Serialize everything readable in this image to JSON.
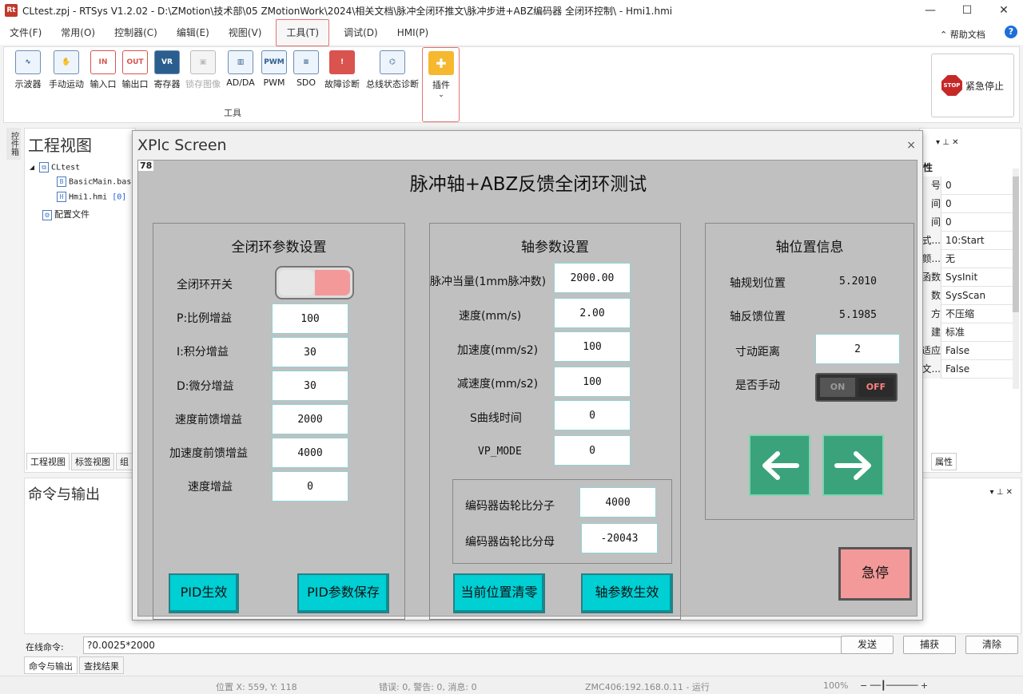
{
  "window": {
    "title": "CLtest.zpj - RTSys V1.2.02 - D:\\ZMotion\\技术部\\05 ZMotionWork\\2024\\相关文档\\脉冲全闭环推文\\脉冲步进+ABZ编码器  全闭环控制\\ - Hmi1.hmi",
    "app_icon": "Rt"
  },
  "menu": [
    "文件(F)",
    "常用(O)",
    "控制器(C)",
    "编辑(E)",
    "视图(V)",
    "工具(T)",
    "调试(D)",
    "HMI(P)"
  ],
  "menu_right": {
    "help": "帮助文档"
  },
  "ribbon": {
    "tools": [
      {
        "label": "示波器",
        "icon": "oscilloscope-icon",
        "glyph": "∿"
      },
      {
        "label": "手动运动",
        "icon": "hand-icon",
        "glyph": "✋"
      },
      {
        "label": "输入口",
        "icon": "input-icon",
        "glyph": "IN"
      },
      {
        "label": "输出口",
        "icon": "output-icon",
        "glyph": "OUT"
      },
      {
        "label": "寄存器",
        "icon": "register-icon",
        "glyph": "VR"
      },
      {
        "label": "锁存图像",
        "icon": "latch-image-icon",
        "glyph": "▣"
      },
      {
        "label": "AD/DA",
        "icon": "adda-icon",
        "glyph": "▥"
      },
      {
        "label": "PWM",
        "icon": "pwm-icon",
        "glyph": "PWM"
      },
      {
        "label": "SDO",
        "icon": "sdo-icon",
        "glyph": "≡"
      },
      {
        "label": "故障诊断",
        "icon": "fault-icon",
        "glyph": "!"
      },
      {
        "label": "总线状态诊断",
        "icon": "bus-icon",
        "glyph": "⌬"
      },
      {
        "label": "插件",
        "icon": "plugin-icon",
        "glyph": "✚"
      }
    ],
    "group_label": "工具",
    "estop": {
      "label": "紧急停止",
      "badge": "STOP"
    }
  },
  "side_tab": "控件箱",
  "project": {
    "header": "工程视图",
    "root": "CLtest",
    "file1": "BasicMain.bas",
    "file2": "Hmi1.hmi",
    "file2_tag": "[0]",
    "config": "配置文件",
    "tabs": [
      "工程视图",
      "标签视图",
      "组"
    ]
  },
  "props": {
    "head": "性",
    "rows": [
      {
        "k": "号",
        "v": "0"
      },
      {
        "k": "间",
        "v": "0"
      },
      {
        "k": "间",
        "v": "0"
      },
      {
        "k": "式...",
        "v": "10:Start"
      },
      {
        "k": "颜...",
        "v": "无"
      },
      {
        "k": "函数",
        "v": "SysInit"
      },
      {
        "k": "数",
        "v": "SysScan"
      },
      {
        "k": "方",
        "v": "不压缩"
      },
      {
        "k": "建",
        "v": "标准"
      },
      {
        "k": "适应",
        "v": "False"
      },
      {
        "k": "文...",
        "v": "False"
      }
    ],
    "tab": "属性"
  },
  "output": {
    "header": "命令与输出"
  },
  "command": {
    "label": "在线命令:",
    "value": "?0.0025*2000",
    "send": "发送",
    "capture": "捕获",
    "clear": "清除"
  },
  "out_tabs": [
    "命令与输出",
    "查找结果"
  ],
  "status": {
    "pos": "位置 X: 559, Y: 118",
    "errors": "错误: 0, 警告: 0, 消息: 0",
    "conn": "ZMC406:192.168.0.11 - 运行",
    "zoom": "100%"
  },
  "xplc": {
    "title": "XPlc Screen",
    "close": "×",
    "tag": "78",
    "main_title": "脉冲轴+ABZ反馈全闭环测试",
    "pid": {
      "title": "全闭环参数设置",
      "switch_label": "全闭环开关",
      "switch_on": true,
      "fields": [
        {
          "label": "P:比例增益",
          "value": "100"
        },
        {
          "label": "I:积分增益",
          "value": "30"
        },
        {
          "label": "D:微分增益",
          "value": "30"
        },
        {
          "label": "速度前馈增益",
          "value": "2000"
        },
        {
          "label": "加速度前馈增益",
          "value": "4000"
        },
        {
          "label": "速度增益",
          "value": "0"
        }
      ],
      "btn_apply": "PID生效",
      "btn_save": "PID参数保存"
    },
    "axis": {
      "title": "轴参数设置",
      "fields": [
        {
          "label": "脉冲当量(1mm脉冲数)",
          "value": "2000.00"
        },
        {
          "label": "速度(mm/s)",
          "value": "2.00"
        },
        {
          "label": "加速度(mm/s2)",
          "value": "100"
        },
        {
          "label": "减速度(mm/s2)",
          "value": "100"
        },
        {
          "label": "S曲线时间",
          "value": "0"
        },
        {
          "label": "VP_MODE",
          "value": "0"
        }
      ],
      "enc_num_label": "编码器齿轮比分子",
      "enc_num": "4000",
      "enc_den_label": "编码器齿轮比分母",
      "enc_den": "-20043",
      "btn_zero": "当前位置清零",
      "btn_apply": "轴参数生效"
    },
    "position": {
      "title": "轴位置信息",
      "plan_label": "轴规划位置",
      "plan_value": "5.2010",
      "fb_label": "轴反馈位置",
      "fb_value": "5.1985",
      "jog_label": "寸动距离",
      "jog_value": "2",
      "manual_label": "是否手动",
      "manual_on": "ON",
      "manual_off": "OFF",
      "estop": "急停"
    }
  }
}
